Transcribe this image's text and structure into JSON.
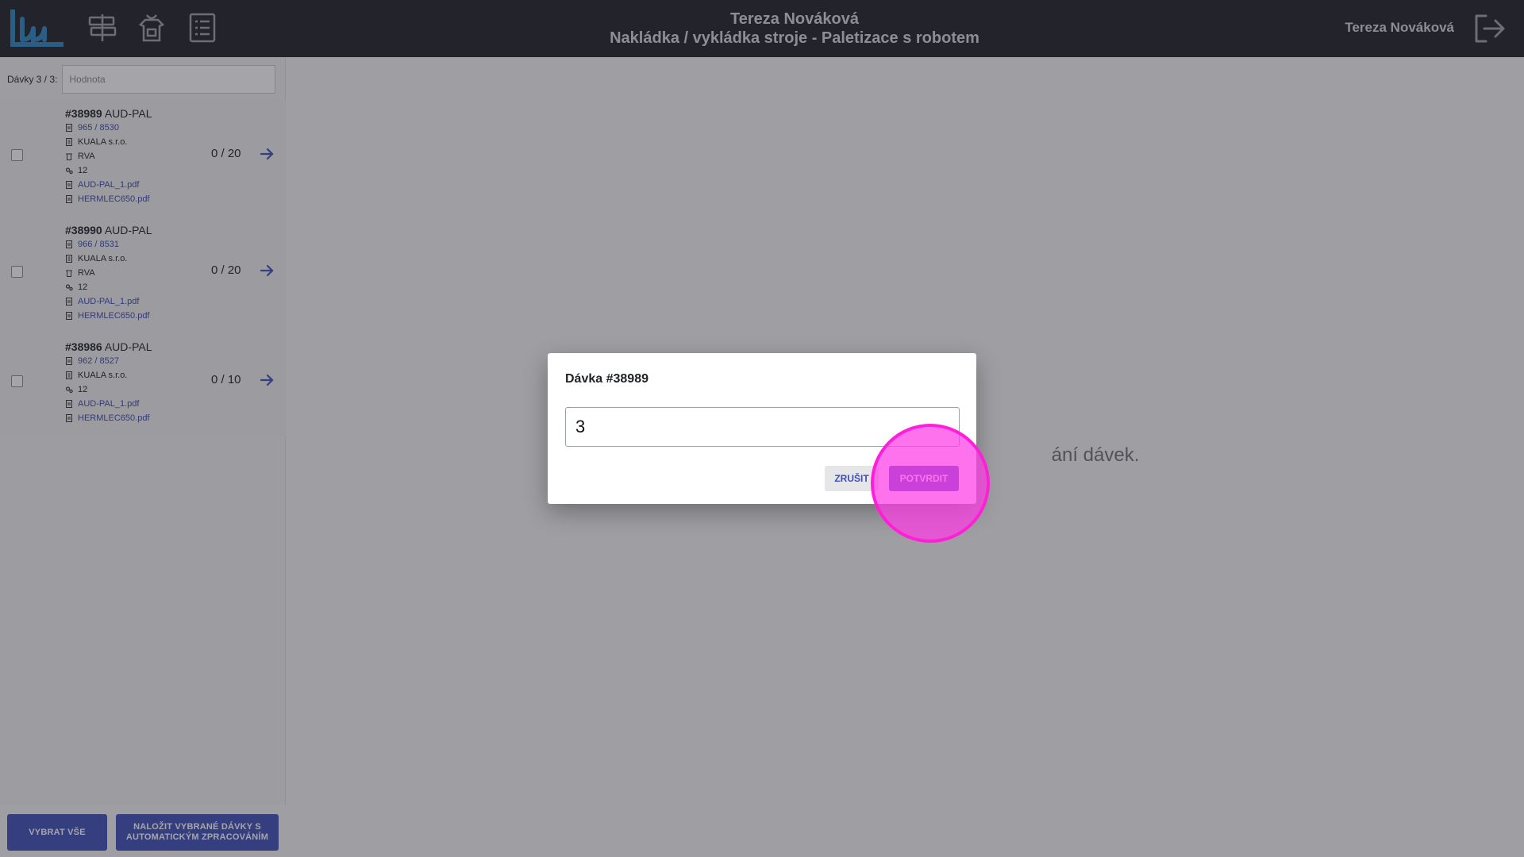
{
  "header": {
    "title_line1": "Tereza Nováková",
    "title_line2": "Nakládka / vykládka stroje - Paletizace s robotem",
    "user_name": "Tereza Nováková",
    "icons": [
      "logo-icon",
      "signpost-icon",
      "apron-icon",
      "list-icon",
      "logout-icon"
    ]
  },
  "sidebar": {
    "filter_label": "Dávky  3 / 3:",
    "filter_placeholder": "Hodnota",
    "batches": [
      {
        "id": "#38989",
        "name": "AUD-PAL",
        "order": "965 / 8530",
        "company": "KUALA s.r.o.",
        "location": "RVA",
        "quantity": "12",
        "file1": "AUD-PAL_1.pdf",
        "file2": "HERMLEC650.pdf",
        "progress": "0 / 20"
      },
      {
        "id": "#38990",
        "name": "AUD-PAL",
        "order": "966 / 8531",
        "company": "KUALA s.r.o.",
        "location": "RVA",
        "quantity": "12",
        "file1": "AUD-PAL_1.pdf",
        "file2": "HERMLEC650.pdf",
        "progress": "0 / 20"
      },
      {
        "id": "#38986",
        "name": "AUD-PAL",
        "order": "962 / 8527",
        "company": "KUALA s.r.o.",
        "quantity": "12",
        "file1": "AUD-PAL_1.pdf",
        "file2": "HERMLEC650.pdf",
        "progress": "0 / 10"
      }
    ],
    "select_all_label": "VYBRAT VŠE",
    "load_selected_label": "NALOŽIT VYBRANÉ DÁVKY S AUTOMATICKÝM ZPRACOVÁNÍM"
  },
  "main": {
    "empty_text_visible": "ání dávek."
  },
  "dialog": {
    "title": "Dávka #38989",
    "input_value": "3",
    "cancel_label": "ZRUŠIT",
    "confirm_label": "POTVRDIT"
  },
  "colors": {
    "header_bg": "#1f2227",
    "accent": "#3f4fb5",
    "click_indicator": "#ff1fd8"
  }
}
